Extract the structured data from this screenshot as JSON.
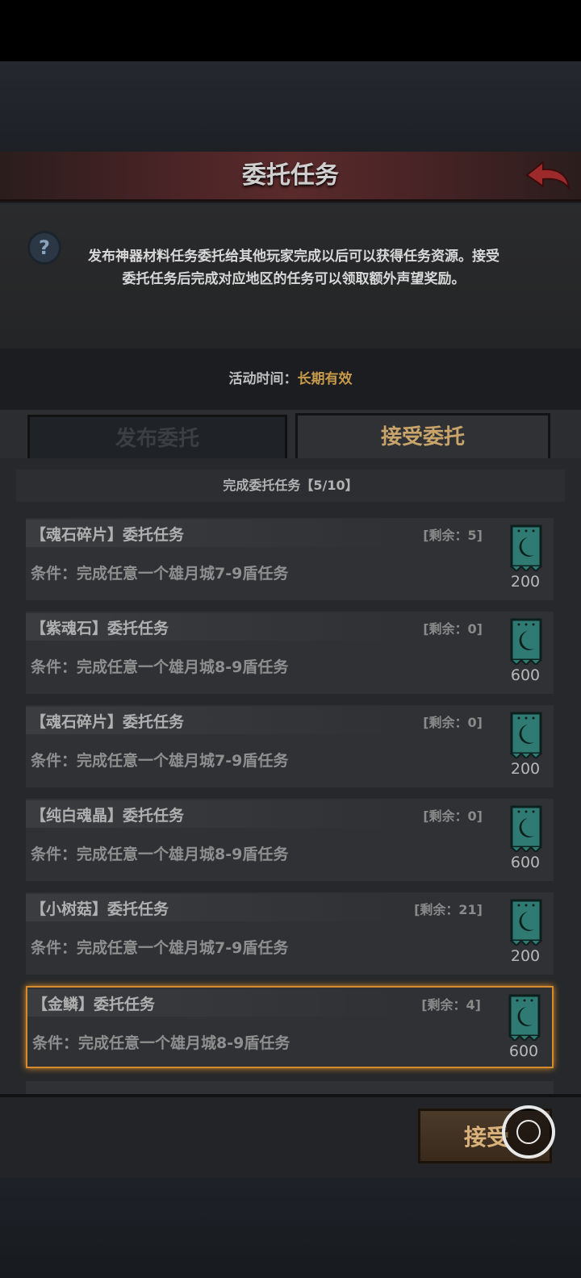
{
  "header": {
    "title": "委托任务"
  },
  "info": {
    "line1": "发布神器材料任务委托给其他玩家完成以后可以获得任务资源。接受",
    "line2": "委托任务后完成对应地区的任务可以领取额外声望奖励。",
    "time_label": "活动时间：",
    "time_value": "长期有效"
  },
  "tabs": [
    {
      "label": "发布委托",
      "active": false
    },
    {
      "label": "接受委托",
      "active": true
    }
  ],
  "list": {
    "header": "完成委托任务【5/10】",
    "items": [
      {
        "title": "【魂石碎片】委托任务",
        "remain": "[剩余：5]",
        "condition": "条件：完成任意一个雄月城7-9盾任务",
        "reward": "200"
      },
      {
        "title": "【紫魂石】委托任务",
        "remain": "[剩余：0]",
        "condition": "条件：完成任意一个雄月城8-9盾任务",
        "reward": "600"
      },
      {
        "title": "【魂石碎片】委托任务",
        "remain": "[剩余：0]",
        "condition": "条件：完成任意一个雄月城7-9盾任务",
        "reward": "200"
      },
      {
        "title": "【纯白魂晶】委托任务",
        "remain": "[剩余：0]",
        "condition": "条件：完成任意一个雄月城8-9盾任务",
        "reward": "600"
      },
      {
        "title": "【小树菇】委托任务",
        "remain": "[剩余：21]",
        "condition": "条件：完成任意一个雄月城7-9盾任务",
        "reward": "200"
      },
      {
        "title": "【金鳞】委托任务",
        "remain": "[剩余：4]",
        "condition": "条件：完成任意一个雄月城8-9盾任务",
        "reward": "600",
        "selected": true
      }
    ]
  },
  "footer": {
    "accept_label": "接受"
  },
  "icons": {
    "back": "back-arrow-icon",
    "help": "help-icon",
    "reward": "crescent-banner-icon"
  },
  "colors": {
    "accent_gold": "#c9a46a",
    "selection": "#d58a2c",
    "title_bar": "#5a2a2b"
  }
}
